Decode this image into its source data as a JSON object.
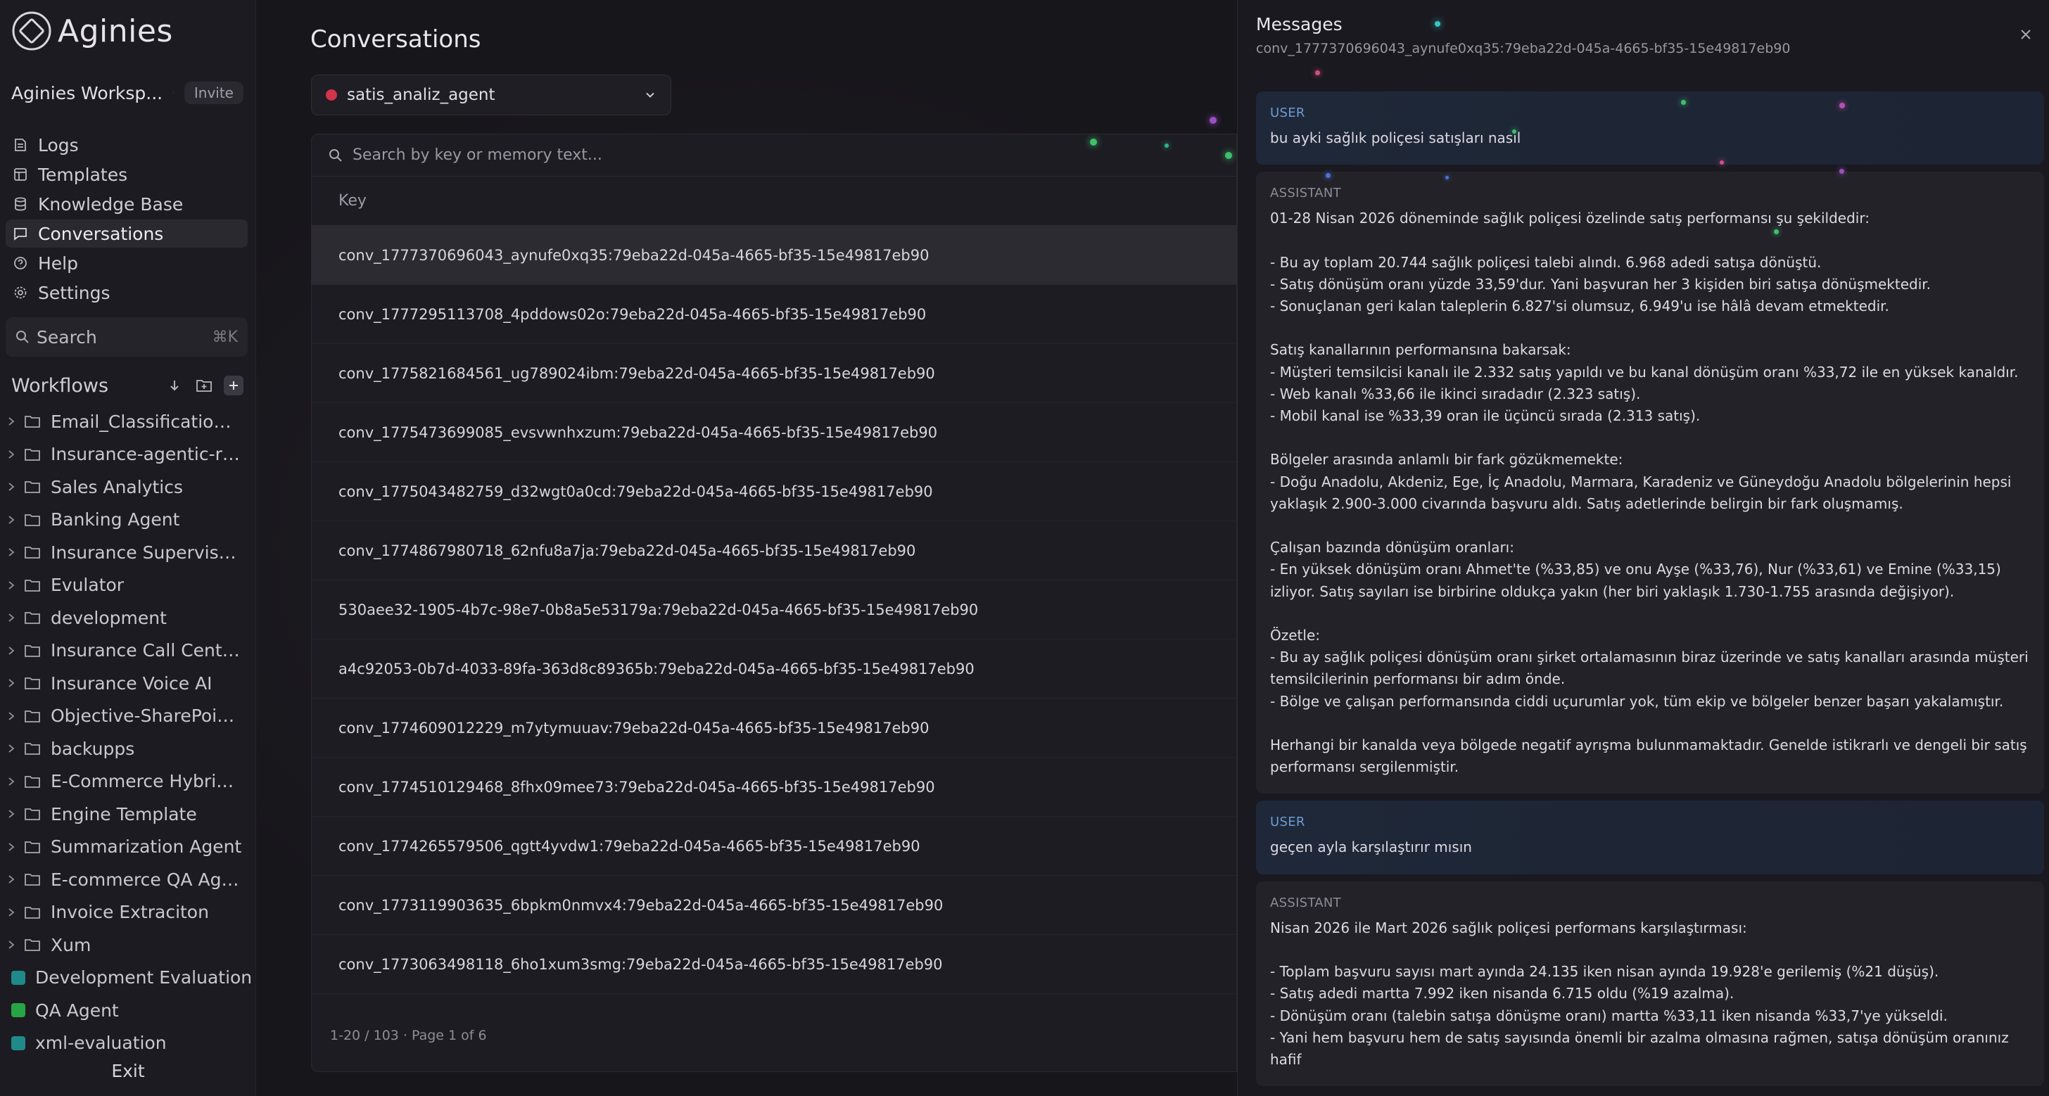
{
  "sidebar": {
    "brand": "Aginies",
    "workspace": {
      "name": "Aginies Worksp...",
      "invite": "Invite"
    },
    "nav": [
      {
        "label": "Logs",
        "icon": "logs-icon"
      },
      {
        "label": "Templates",
        "icon": "templates-icon"
      },
      {
        "label": "Knowledge Base",
        "icon": "database-icon"
      },
      {
        "label": "Conversations",
        "icon": "chat-icon",
        "active": true
      },
      {
        "label": "Help",
        "icon": "help-icon"
      },
      {
        "label": "Settings",
        "icon": "gear-icon"
      }
    ],
    "search": {
      "label": "Search",
      "shortcut": "⌘K"
    },
    "workflows": {
      "title": "Workflows",
      "folders": [
        "Email_Classification_...",
        "Insurance-agentic-rag...",
        "Sales Analytics",
        "Banking Agent",
        "Insurance Supervisor ...",
        "Evulator",
        "development",
        "Insurance Call Center ...",
        "Insurance Voice AI",
        "Objective-SharePoint ...",
        "backupps",
        "E-Commerce Hybrid E...",
        "Engine Template",
        "Summarization Agent",
        "E-commerce QA Agent",
        "Invoice Extraciton",
        "Xum"
      ],
      "evaluations": [
        {
          "label": "Development Evaluation",
          "color": "#1e8a8a"
        },
        {
          "label": "QA Agent",
          "color": "#27a544"
        },
        {
          "label": "xml-evaluation",
          "color": "#1e8a8a"
        }
      ]
    },
    "exit": "Exit"
  },
  "main": {
    "title": "Conversations",
    "agent": {
      "name": "satis_analiz_agent",
      "status_color": "#d1344b"
    },
    "search_placeholder": "Search by key or memory text...",
    "column_key": "Key",
    "rows": [
      "conv_1777370696043_aynufe0xq35:79eba22d-045a-4665-bf35-15e49817eb90",
      "conv_1777295113708_4pddows02o:79eba22d-045a-4665-bf35-15e49817eb90",
      "conv_1775821684561_ug789024ibm:79eba22d-045a-4665-bf35-15e49817eb90",
      "conv_1775473699085_evsvwnhxzum:79eba22d-045a-4665-bf35-15e49817eb90",
      "conv_1775043482759_d32wgt0a0cd:79eba22d-045a-4665-bf35-15e49817eb90",
      "conv_1774867980718_62nfu8a7ja:79eba22d-045a-4665-bf35-15e49817eb90",
      "530aee32-1905-4b7c-98e7-0b8a5e53179a:79eba22d-045a-4665-bf35-15e49817eb90",
      "a4c92053-0b7d-4033-89fa-363d8c89365b:79eba22d-045a-4665-bf35-15e49817eb90",
      "conv_1774609012229_m7ytymuuav:79eba22d-045a-4665-bf35-15e49817eb90",
      "conv_1774510129468_8fhx09mee73:79eba22d-045a-4665-bf35-15e49817eb90",
      "conv_1774265579506_qgtt4yvdw1:79eba22d-045a-4665-bf35-15e49817eb90",
      "conv_1773119903635_6bpkm0nmvx4:79eba22d-045a-4665-bf35-15e49817eb90",
      "conv_1773063498118_6ho1xum3smg:79eba22d-045a-4665-bf35-15e49817eb90"
    ],
    "pager": "1-20 / 103 · Page 1 of 6"
  },
  "panel": {
    "title": "Messages",
    "subtitle": "conv_1777370696043_aynufe0xq35:79eba22d-045a-4665-bf35-15e49817eb90",
    "messages": [
      {
        "role": "USER",
        "text": "bu ayki sağlık poliçesi satışları nasıl"
      },
      {
        "role": "ASSISTANT",
        "text": "01-28 Nisan 2026 döneminde sağlık poliçesi özelinde satış performansı şu şekildedir:\n\n- Bu ay toplam 20.744 sağlık poliçesi talebi alındı. 6.968 adedi satışa dönüştü.\n- Satış dönüşüm oranı yüzde 33,59'dur. Yani başvuran her 3 kişiden biri satışa dönüşmektedir.\n- Sonuçlanan geri kalan taleplerin 6.827'si olumsuz, 6.949'u ise hâlâ devam etmektedir.\n\nSatış kanallarının performansına bakarsak:\n- Müşteri temsilcisi kanalı ile 2.332 satış yapıldı ve bu kanal dönüşüm oranı %33,72 ile en yüksek kanaldır.\n- Web kanalı %33,66 ile ikinci sıradadır (2.323 satış).\n- Mobil kanal ise %33,39 oran ile üçüncü sırada (2.313 satış).\n\nBölgeler arasında anlamlı bir fark gözükmemekte:\n- Doğu Anadolu, Akdeniz, Ege, İç Anadolu, Marmara, Karadeniz ve Güneydoğu Anadolu bölgelerinin hepsi yaklaşık 2.900-3.000 civarında başvuru aldı. Satış adetlerinde belirgin bir fark oluşmamış.\n\nÇalışan bazında dönüşüm oranları:\n- En yüksek dönüşüm oranı Ahmet'te (%33,85) ve onu Ayşe (%33,76), Nur (%33,61) ve Emine (%33,15) izliyor. Satış sayıları ise birbirine oldukça yakın (her biri yaklaşık 1.730-1.755 arasında değişiyor).\n\nÖzetle:\n- Bu ay sağlık poliçesi dönüşüm oranı şirket ortalamasının biraz üzerinde ve satış kanalları arasında müşteri temsilcilerinin performansı bir adım önde.\n- Bölge ve çalışan performansında ciddi uçurumlar yok, tüm ekip ve bölgeler benzer başarı yakalamıştır.\n\nHerhangi bir kanalda veya bölgede negatif ayrışma bulunmamaktadır. Genelde istikrarlı ve dengeli bir satış performansı sergilenmiştir."
      },
      {
        "role": "USER",
        "text": "geçen ayla karşılaştırır mısın"
      },
      {
        "role": "ASSISTANT",
        "text": "Nisan 2026 ile Mart 2026 sağlık poliçesi performans karşılaştırması:\n\n- Toplam başvuru sayısı mart ayında 24.135 iken nisan ayında 19.928'e gerilemiş (%21 düşüş).\n- Satış adedi martta 7.992 iken nisanda 6.715 oldu (%19 azalma).\n- Dönüşüm oranı (talebin satışa dönüşme oranı) martta %33,11 iken nisanda %33,7'ye yükseldi.\n- Yani hem başvuru hem de satış sayısında önemli bir azalma olmasına rağmen, satışa dönüşüm oranınız hafif"
      }
    ]
  }
}
